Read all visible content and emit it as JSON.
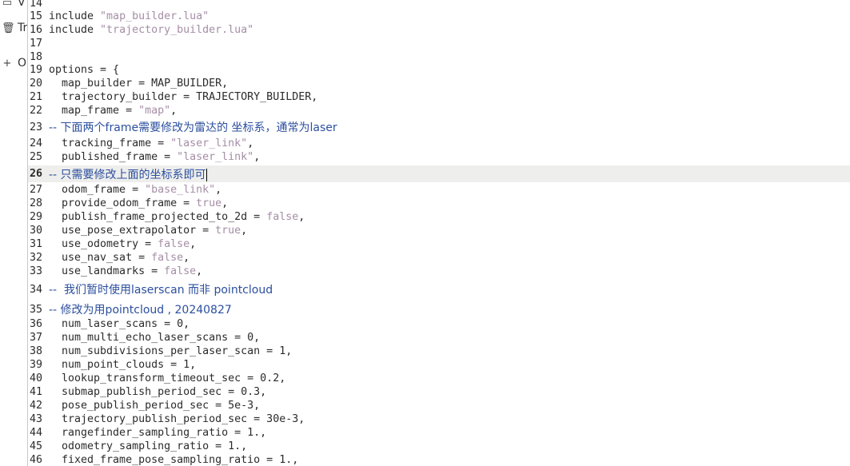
{
  "sidebar": {
    "items": [
      {
        "icon": "window-icon",
        "glyph": "▭",
        "label": "V"
      },
      {
        "icon": "trash-icon",
        "glyph": "🗑",
        "label": "Tr"
      },
      {
        "icon": "plus-icon",
        "glyph": "+",
        "label": "O"
      }
    ]
  },
  "editor": {
    "current_line": "26",
    "lines": [
      {
        "n": "14",
        "parts": [
          {
            "t": "",
            "c": ""
          }
        ]
      },
      {
        "n": "15",
        "parts": [
          {
            "t": "include ",
            "c": ""
          },
          {
            "t": "\"map_builder.lua\"",
            "c": "str"
          }
        ]
      },
      {
        "n": "16",
        "parts": [
          {
            "t": "include ",
            "c": ""
          },
          {
            "t": "\"trajectory_builder.lua\"",
            "c": "str"
          }
        ]
      },
      {
        "n": "17",
        "parts": [
          {
            "t": "",
            "c": ""
          }
        ]
      },
      {
        "n": "18",
        "parts": [
          {
            "t": "",
            "c": ""
          }
        ]
      },
      {
        "n": "19",
        "parts": [
          {
            "t": "options = {",
            "c": ""
          }
        ]
      },
      {
        "n": "20",
        "parts": [
          {
            "t": "  map_builder = MAP_BUILDER,",
            "c": ""
          }
        ]
      },
      {
        "n": "21",
        "parts": [
          {
            "t": "  trajectory_builder = TRAJECTORY_BUILDER,",
            "c": ""
          }
        ]
      },
      {
        "n": "22",
        "parts": [
          {
            "t": "  map_frame = ",
            "c": ""
          },
          {
            "t": "\"map\"",
            "c": "str"
          },
          {
            "t": ",",
            "c": ""
          }
        ]
      },
      {
        "n": "23",
        "parts": [
          {
            "t": "-- 下面两个frame需要修改为雷达的 坐标系，通常为laser",
            "c": "cmt"
          }
        ]
      },
      {
        "n": "24",
        "parts": [
          {
            "t": "  tracking_frame = ",
            "c": ""
          },
          {
            "t": "\"laser_link\"",
            "c": "str"
          },
          {
            "t": ",",
            "c": ""
          }
        ]
      },
      {
        "n": "25",
        "parts": [
          {
            "t": "  published_frame = ",
            "c": ""
          },
          {
            "t": "\"laser_link\"",
            "c": "str"
          },
          {
            "t": ",",
            "c": ""
          }
        ]
      },
      {
        "n": "26",
        "parts": [
          {
            "t": "-- 只需要修改上面的坐标系即可",
            "c": "cmt"
          }
        ]
      },
      {
        "n": "27",
        "parts": [
          {
            "t": "  odom_frame = ",
            "c": ""
          },
          {
            "t": "\"base_link\"",
            "c": "str"
          },
          {
            "t": ",",
            "c": ""
          }
        ]
      },
      {
        "n": "28",
        "parts": [
          {
            "t": "  provide_odom_frame = ",
            "c": ""
          },
          {
            "t": "true",
            "c": "kw"
          },
          {
            "t": ",",
            "c": ""
          }
        ]
      },
      {
        "n": "29",
        "parts": [
          {
            "t": "  publish_frame_projected_to_2d = ",
            "c": ""
          },
          {
            "t": "false",
            "c": "kw"
          },
          {
            "t": ",",
            "c": ""
          }
        ]
      },
      {
        "n": "30",
        "parts": [
          {
            "t": "  use_pose_extrapolator = ",
            "c": ""
          },
          {
            "t": "true",
            "c": "kw"
          },
          {
            "t": ",",
            "c": ""
          }
        ]
      },
      {
        "n": "31",
        "parts": [
          {
            "t": "  use_odometry = ",
            "c": ""
          },
          {
            "t": "false",
            "c": "kw"
          },
          {
            "t": ",",
            "c": ""
          }
        ]
      },
      {
        "n": "32",
        "parts": [
          {
            "t": "  use_nav_sat = ",
            "c": ""
          },
          {
            "t": "false",
            "c": "kw"
          },
          {
            "t": ",",
            "c": ""
          }
        ]
      },
      {
        "n": "33",
        "parts": [
          {
            "t": "  use_landmarks = ",
            "c": ""
          },
          {
            "t": "false",
            "c": "kw"
          },
          {
            "t": ",",
            "c": ""
          }
        ]
      },
      {
        "n": "34",
        "parts": [
          {
            "t": "--  我们暂时使用laserscan 而非 pointcloud",
            "c": "cmt"
          }
        ]
      },
      {
        "n": "35",
        "parts": [
          {
            "t": "-- 修改为用pointcloud , 20240827",
            "c": "cmt"
          }
        ]
      },
      {
        "n": "36",
        "parts": [
          {
            "t": "  num_laser_scans = 0,",
            "c": ""
          }
        ]
      },
      {
        "n": "37",
        "parts": [
          {
            "t": "  num_multi_echo_laser_scans = 0,",
            "c": ""
          }
        ]
      },
      {
        "n": "38",
        "parts": [
          {
            "t": "  num_subdivisions_per_laser_scan = 1,",
            "c": ""
          }
        ]
      },
      {
        "n": "39",
        "parts": [
          {
            "t": "  num_point_clouds = 1,",
            "c": ""
          }
        ]
      },
      {
        "n": "40",
        "parts": [
          {
            "t": "  lookup_transform_timeout_sec = 0.2,",
            "c": ""
          }
        ]
      },
      {
        "n": "41",
        "parts": [
          {
            "t": "  submap_publish_period_sec = 0.3,",
            "c": ""
          }
        ]
      },
      {
        "n": "42",
        "parts": [
          {
            "t": "  pose_publish_period_sec = 5e-3,",
            "c": ""
          }
        ]
      },
      {
        "n": "43",
        "parts": [
          {
            "t": "  trajectory_publish_period_sec = 30e-3,",
            "c": ""
          }
        ]
      },
      {
        "n": "44",
        "parts": [
          {
            "t": "  rangefinder_sampling_ratio = 1.,",
            "c": ""
          }
        ]
      },
      {
        "n": "45",
        "parts": [
          {
            "t": "  odometry_sampling_ratio = 1.,",
            "c": ""
          }
        ]
      },
      {
        "n": "46",
        "parts": [
          {
            "t": "  fixed_frame_pose_sampling_ratio = 1.,",
            "c": ""
          }
        ]
      }
    ]
  }
}
